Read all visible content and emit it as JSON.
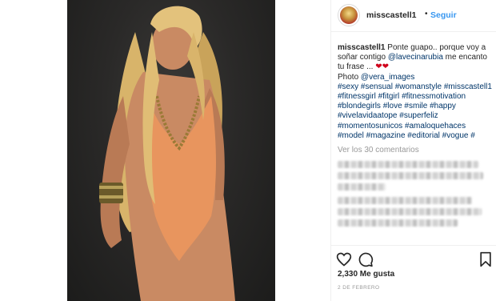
{
  "post": {
    "username": "misscastell1",
    "separator": "•",
    "follow_label": "Seguir",
    "caption": {
      "author": "misscastell1",
      "text_1": "Ponte guapo.. porque voy a soñar contigo ",
      "mention_1": "@lavecinarubia",
      "text_2": " me encanto tu frase ... ",
      "hearts": "❤❤",
      "photo_credit_label": "Photo ",
      "mention_2": "@vera_images",
      "hashtags": [
        "#sexy",
        "#sensual",
        "#womanstyle",
        "#misscastell1",
        "#fitnessgirl",
        "#fitgirl",
        "#fitnessmotivation",
        "#blondegirls",
        "#love",
        "#smile",
        "#happy",
        "#vivelavidaatope",
        "#superfeliz",
        "#momentosunicos",
        "#amaloquehaces",
        "#model",
        "#magazine",
        "#editorial",
        "#vogue",
        "#"
      ]
    },
    "view_comments_label": "Ver los 30 comentarios",
    "likes_label": "2,330 Me gusta",
    "date_label": "2 DE FEBRERO",
    "icons": [
      "heart-icon",
      "comment-icon",
      "bookmark-icon"
    ],
    "colors": {
      "link": "#3897f0",
      "tag": "#003569",
      "muted": "#999999",
      "suit": "#e8955e"
    }
  }
}
